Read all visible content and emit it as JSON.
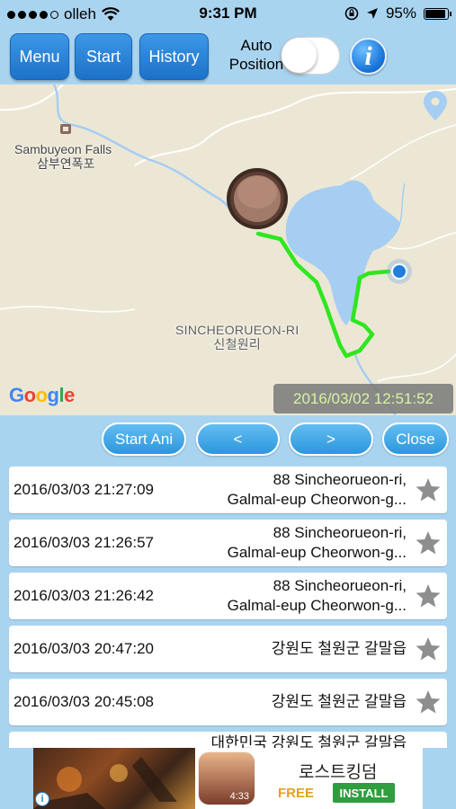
{
  "status_bar": {
    "carrier": "olleh",
    "time": "9:31 PM",
    "battery": "95%",
    "battery_level": 0.95
  },
  "toolbar": {
    "menu_label": "Menu",
    "start_label": "Start",
    "history_label": "History",
    "auto_position_line1": "Auto",
    "auto_position_line2": "Position",
    "auto_position_on": false,
    "info_label": "i"
  },
  "map": {
    "falls_label_en": "Sambuyeon Falls",
    "falls_label_ko": "삼부연폭포",
    "region_label_en": "SINCHEORUEON-RI",
    "region_label_ko": "신철원리",
    "attribution": "Google",
    "timestamp": "2016/03/02 12:51:52",
    "track_color": "#2fe61f",
    "water_color": "#a6cdf2"
  },
  "playback": {
    "start_ani_label": "Start Ani",
    "prev_label": "<",
    "next_label": ">",
    "close_label": "Close"
  },
  "history": [
    {
      "date": "2016/03/03 21:27:09",
      "addr1": "88 Sincheorueon-ri,",
      "addr2": "Galmal-eup Cheorwon-g..."
    },
    {
      "date": "2016/03/03 21:26:57",
      "addr1": "88 Sincheorueon-ri,",
      "addr2": "Galmal-eup Cheorwon-g..."
    },
    {
      "date": "2016/03/03 21:26:42",
      "addr1": "88 Sincheorueon-ri,",
      "addr2": "Galmal-eup Cheorwon-g..."
    },
    {
      "date": "2016/03/03 20:47:20",
      "addr1": "강원도 철원군 갈말읍",
      "addr2": ""
    },
    {
      "date": "2016/03/03 20:45:08",
      "addr1": "강원도 철원군 갈말읍",
      "addr2": ""
    },
    {
      "date": "",
      "addr1": "대한민국 강원도 철원군 갈말읍",
      "addr2": ""
    }
  ],
  "ad": {
    "title": "로스트킹덤",
    "free_label": "FREE",
    "install_label": "INSTALL",
    "icon_time": "4:33",
    "info_label": "i"
  }
}
